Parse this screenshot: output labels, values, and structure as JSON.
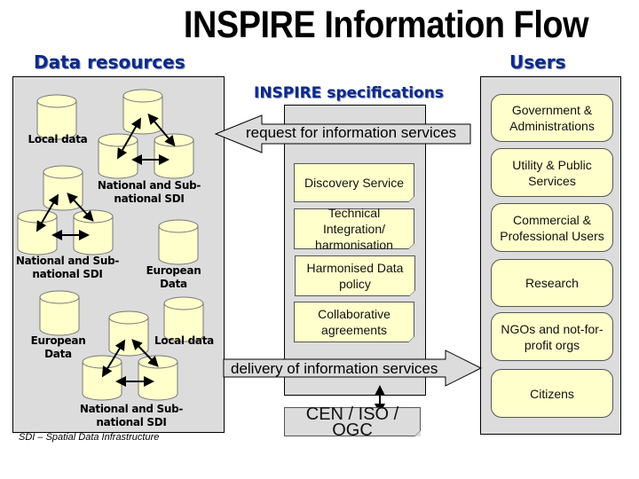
{
  "title": "INSPIRE Information Flow",
  "headings": {
    "data_resources": "Data resources",
    "users": "Users",
    "specifications": "INSPIRE specifications"
  },
  "data_resources": {
    "labels": {
      "local_data_top": "Local data",
      "sdi_top": [
        "National and Sub-",
        "national  SDI"
      ],
      "sdi_middle": [
        "National and Sub-",
        "national  SDI"
      ],
      "european_data_right": "European Data",
      "european_data_left": "European Data",
      "local_data_bottom": "Local data",
      "sdi_bottom": [
        "National and Sub-",
        "national  SDI"
      ]
    },
    "footnote": "SDI – Spatial Data Infrastructure"
  },
  "flows": {
    "request": "request for information services",
    "delivery": "delivery of information services"
  },
  "specifications": [
    "Discovery Service",
    "Technical Integration/ harmonisation",
    "Harmonised Data policy",
    "Collaborative agreements"
  ],
  "standards": "CEN / ISO / OGC",
  "users": [
    "Government & Administrations",
    "Utility & Public Services",
    "Commercial & Professional Users",
    "Research",
    "NGOs and not-for-profit orgs",
    "Citizens"
  ],
  "colors": {
    "heading": "#0d2a8a",
    "panel": "#dcdcdc",
    "note_fill": "#ffffcc"
  }
}
